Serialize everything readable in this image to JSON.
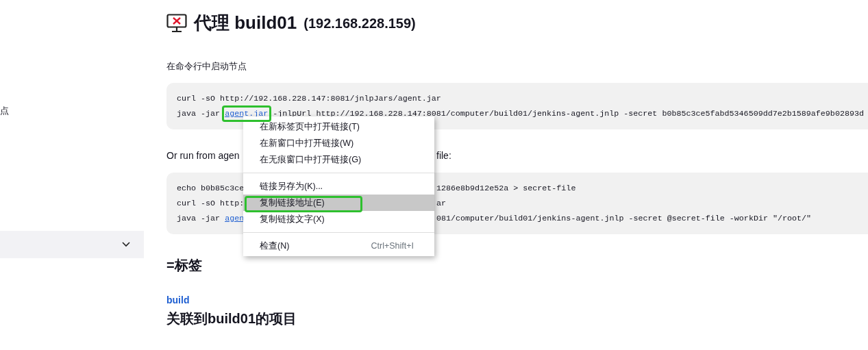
{
  "sidebar": {
    "items": [
      {
        "label": "点"
      }
    ],
    "section": {
      "expanded": false
    }
  },
  "heading": {
    "title": "代理 build01",
    "address": "(192.168.228.159)"
  },
  "intro": "在命令行中启动节点",
  "code_block_1": [
    {
      "segments": [
        [
          {
            "kind": "text",
            "text": "curl -sO http://192.168.228.147:8081/jnlpJars/agent.jar"
          }
        ]
      ]
    },
    {
      "segments": [
        [
          {
            "kind": "text",
            "text": "java -jar "
          },
          {
            "kind": "link",
            "text": "agent.jar"
          },
          {
            "kind": "text",
            "text": " -jnlpUrl http://192.168.228.147:8081/computer/build01/jenkins-agent.jnlp -secret b0b85c3ce5fabd5346509dd7e2b1589afe9b02893d"
          }
        ]
      ]
    }
  ],
  "secret_note": [
    "Or run from agen",
    "file:"
  ],
  "code_block_2": [
    {
      "segments": [
        [
          {
            "kind": "text",
            "text": "echo b0b85c3ce"
          }
        ],
        [
          {
            "kind": "text",
            "text": "1286e8b9d12e52a > secret-file"
          }
        ]
      ]
    },
    {
      "segments": [
        [
          {
            "kind": "text",
            "text": "curl -sO http:"
          }
        ],
        [
          {
            "kind": "text",
            "text": "ar"
          }
        ]
      ]
    },
    {
      "segments": [
        [
          {
            "kind": "text",
            "text": "java -jar "
          },
          {
            "kind": "link",
            "text": "agen"
          }
        ],
        [
          {
            "kind": "text",
            "text": "081/computer/build01/jenkins-agent.jnlp -secret @secret-file -workDir \"/root/\""
          }
        ]
      ]
    }
  ],
  "labels_heading": "=标签",
  "labels": [
    {
      "text": "build"
    }
  ],
  "projects_heading": "关联到build01的项目",
  "context_menu": {
    "groups": [
      [
        {
          "label": "在新标签页中打开链接(T)",
          "selected": false
        },
        {
          "label": "在新窗口中打开链接(W)",
          "selected": false
        },
        {
          "label": "在无痕窗口中打开链接(G)",
          "selected": false
        }
      ],
      [
        {
          "label": "链接另存为(K)...",
          "selected": false
        },
        {
          "label": "复制链接地址(E)",
          "selected": true
        },
        {
          "label": "复制链接文字(X)",
          "selected": false
        }
      ],
      [
        {
          "label": "检查(N)",
          "shortcut": "Ctrl+Shift+I",
          "selected": false
        }
      ]
    ]
  }
}
